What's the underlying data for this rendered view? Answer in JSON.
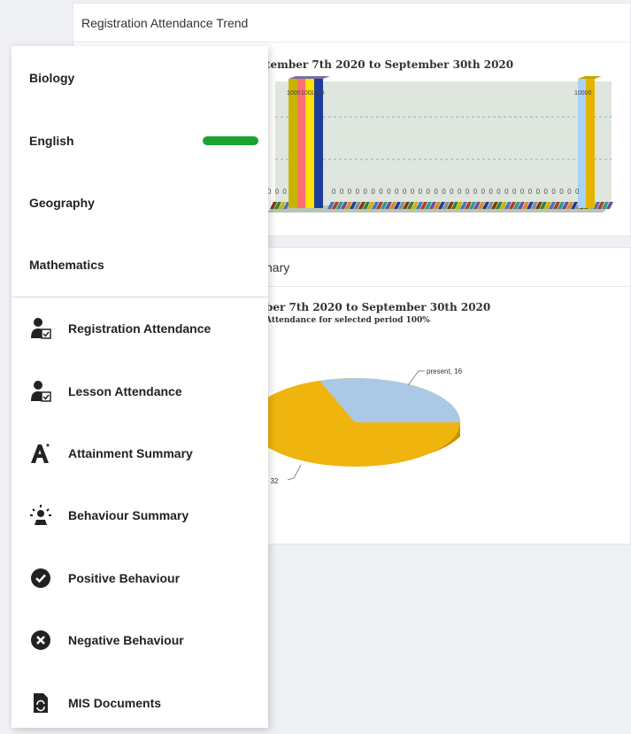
{
  "trend_card": {
    "header": "Registration Attendance Trend"
  },
  "summary_card": {
    "header_fragment": "nary"
  },
  "chart_data": [
    {
      "type": "bar",
      "title_fragment": "tember 7th 2020 to September 30th 2020",
      "bar_labels": [
        "1000",
        "100",
        "1000",
        "10000"
      ],
      "zero_label_left": "0 0 0",
      "zero_label_right": "0 0 0 0 0 0 0 0 0 0 0 0 0 0 0 0 0 0 0 0 0 0 0 0 0 0 0 0 0 0 0 0",
      "colors": [
        "#c8b400",
        "#ff6f6f",
        "#ffe000",
        "#1d3c9c",
        "#a9d3f5",
        "#e5b400"
      ]
    },
    {
      "type": "pie",
      "title_fragment": "ber 7th 2020 to September 30th 2020",
      "subtitle_fragment": "Attendance for selected period 100%",
      "slices": [
        {
          "label": "present, 16",
          "value": 16,
          "color": "#a9c9e6"
        },
        {
          "label": ", 32",
          "value": 32,
          "color": "#f0b40e"
        }
      ]
    }
  ],
  "menu": {
    "subjects": [
      {
        "label": "Biology"
      },
      {
        "label": "English"
      },
      {
        "label": "Geography"
      },
      {
        "label": "Mathematics"
      }
    ],
    "items": [
      {
        "label": "Registration Attendance",
        "icon": "person-check-icon"
      },
      {
        "label": "Lesson Attendance",
        "icon": "person-check-icon"
      },
      {
        "label": "Attainment Summary",
        "icon": "letter-a-star-icon"
      },
      {
        "label": "Behaviour Summary",
        "icon": "sparkle-person-icon"
      },
      {
        "label": "Positive Behaviour",
        "icon": "check-circle-icon"
      },
      {
        "label": "Negative Behaviour",
        "icon": "x-circle-icon"
      },
      {
        "label": "MIS Documents",
        "icon": "document-sync-icon"
      }
    ]
  },
  "colors": {
    "accent_green": "#1aa333",
    "text": "#222222"
  }
}
